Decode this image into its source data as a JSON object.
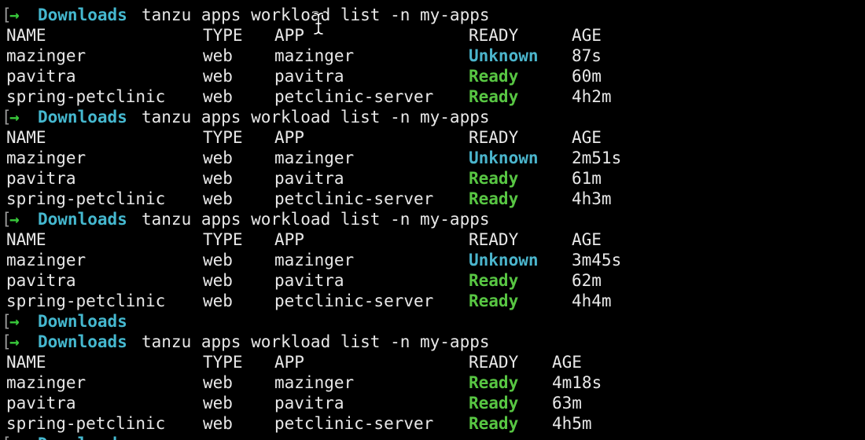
{
  "terminal": {
    "prompt_bracket": "[",
    "prompt_arrow": "→",
    "cwd": "Downloads",
    "command": "tanzu apps workload list -n my-apps",
    "partial_last_line": "Downloads",
    "colors": {
      "background": "#000000",
      "text": "#e8e8e8",
      "prompt_arrow": "#38c93b",
      "cwd": "#45b8cf",
      "ready": "#58c643",
      "unknown": "#4bb5cc"
    },
    "headers": {
      "name": "NAME",
      "type": "TYPE",
      "app": "APP",
      "ready": "READY",
      "age": "AGE"
    },
    "runs": [
      {
        "rows": [
          {
            "name": "mazinger",
            "type": "web",
            "app": "mazinger",
            "ready": "Unknown",
            "age": "87s"
          },
          {
            "name": "pavitra",
            "type": "web",
            "app": "pavitra",
            "ready": "Ready",
            "age": "60m"
          },
          {
            "name": "spring-petclinic",
            "type": "web",
            "app": "petclinic-server",
            "ready": "Ready",
            "age": "4h2m"
          }
        ]
      },
      {
        "rows": [
          {
            "name": "mazinger",
            "type": "web",
            "app": "mazinger",
            "ready": "Unknown",
            "age": "2m51s"
          },
          {
            "name": "pavitra",
            "type": "web",
            "app": "pavitra",
            "ready": "Ready",
            "age": "61m"
          },
          {
            "name": "spring-petclinic",
            "type": "web",
            "app": "petclinic-server",
            "ready": "Ready",
            "age": "4h3m"
          }
        ]
      },
      {
        "rows": [
          {
            "name": "mazinger",
            "type": "web",
            "app": "mazinger",
            "ready": "Unknown",
            "age": "3m45s"
          },
          {
            "name": "pavitra",
            "type": "web",
            "app": "pavitra",
            "ready": "Ready",
            "age": "62m"
          },
          {
            "name": "spring-petclinic",
            "type": "web",
            "app": "petclinic-server",
            "ready": "Ready",
            "age": "4h4m"
          }
        ]
      },
      {
        "rows": [
          {
            "name": "mazinger",
            "type": "web",
            "app": "mazinger",
            "ready": "Ready",
            "age": "4m18s"
          },
          {
            "name": "pavitra",
            "type": "web",
            "app": "pavitra",
            "ready": "Ready",
            "age": "63m"
          },
          {
            "name": "spring-petclinic",
            "type": "web",
            "app": "petclinic-server",
            "ready": "Ready",
            "age": "4h5m"
          }
        ]
      }
    ]
  }
}
